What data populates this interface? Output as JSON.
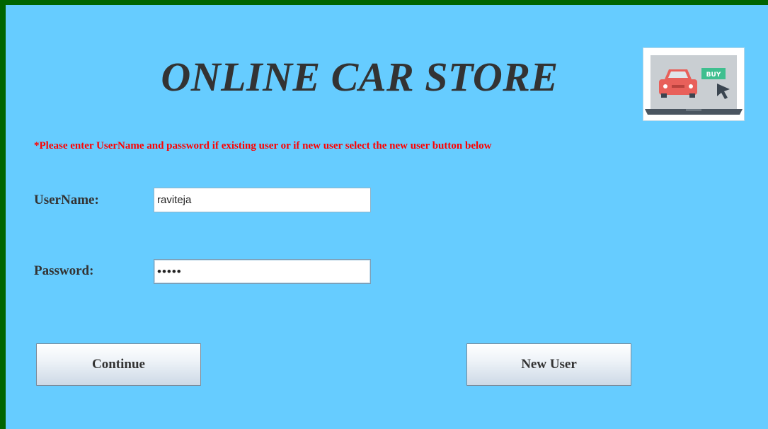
{
  "header": {
    "title": "ONLINE CAR STORE",
    "logo": {
      "icon": "car-buy-laptop-icon",
      "badge_text": "BUY"
    }
  },
  "form": {
    "instruction": "*Please enter UserName and password if existing user or if new user select the new user button below",
    "username": {
      "label": "UserName:",
      "value": "raviteja"
    },
    "password": {
      "label": "Password:",
      "value": "•••••"
    }
  },
  "actions": {
    "continue_label": "Continue",
    "new_user_label": "New User"
  },
  "colors": {
    "frame": "#006400",
    "background": "#66ccff",
    "instruction": "#ff0000",
    "text": "#333333"
  }
}
